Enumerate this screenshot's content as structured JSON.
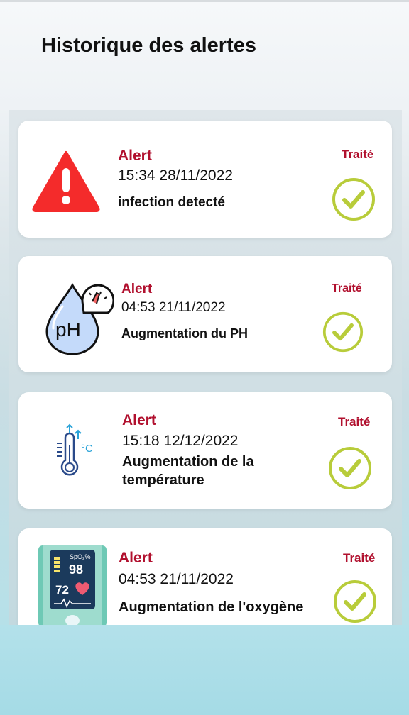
{
  "header": {
    "title": "Historique des alertes"
  },
  "alerts": [
    {
      "icon": "warning-triangle-icon",
      "label": "Alert",
      "time": "15:34 28/11/2022",
      "message": "infection detecté",
      "status": "Traité",
      "status_icon": "check-circle-icon"
    },
    {
      "icon": "ph-drop-gauge-icon",
      "label": "Alert",
      "time": "04:53 21/11/2022",
      "message": "Augmentation du PH",
      "status": "Traité",
      "status_icon": "check-circle-icon",
      "icon_text": "pH"
    },
    {
      "icon": "thermometer-icon",
      "label": "Alert",
      "time": "15:18 12/12/2022",
      "message": "Augmentation de la température",
      "status": "Traité",
      "status_icon": "check-circle-icon",
      "icon_text": "°C"
    },
    {
      "icon": "pulse-oximeter-icon",
      "label": "Alert",
      "time": "04:53 21/11/2022",
      "message": "Augmentation de l'oxygène",
      "status": "Traité",
      "status_icon": "check-circle-icon",
      "icon_texts": {
        "spo2": "SpO₂%",
        "spo2_value": "98",
        "pulse_value": "72"
      }
    }
  ],
  "colors": {
    "alert_red": "#b1102e",
    "check_green": "#b8cc3a",
    "warning_red": "#f42b2b"
  }
}
